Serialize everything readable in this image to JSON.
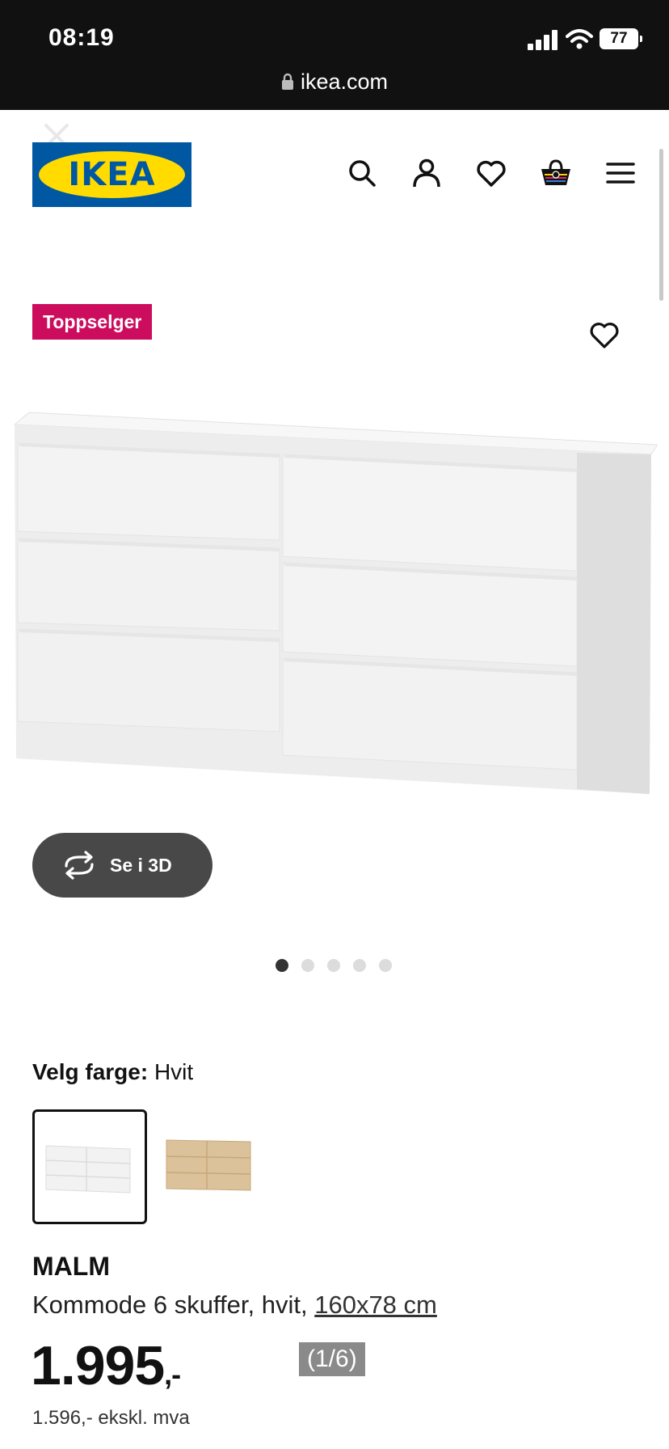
{
  "status_bar": {
    "time": "08:19",
    "battery": "77"
  },
  "browser": {
    "url": "ikea.com"
  },
  "header": {
    "logo_text": "IKEA",
    "icons": [
      "search-icon",
      "account-icon",
      "heart-icon",
      "basket-icon",
      "menu-icon"
    ]
  },
  "product": {
    "badge": "Toppselger",
    "view_3d_label": "Se i 3D",
    "image_dots_total": 5,
    "image_dots_active": 1,
    "color_label": "Velg farge:",
    "color_value": "Hvit",
    "color_options": [
      "Hvit",
      "Eik"
    ],
    "name": "MALM",
    "description": "Kommode 6 skuffer, hvit,",
    "size_link": "160x78 cm",
    "price_main": "1.995",
    "price_suffix": ",-",
    "image_counter": "(1/6)",
    "price_ex_vat": "1.596,- ekskl. mva"
  },
  "colors": {
    "topbar": "#111111",
    "ikea_blue": "#0058a3",
    "ikea_yellow": "#ffdb00",
    "badge": "#cc0d5e",
    "button_3d": "#484848"
  }
}
